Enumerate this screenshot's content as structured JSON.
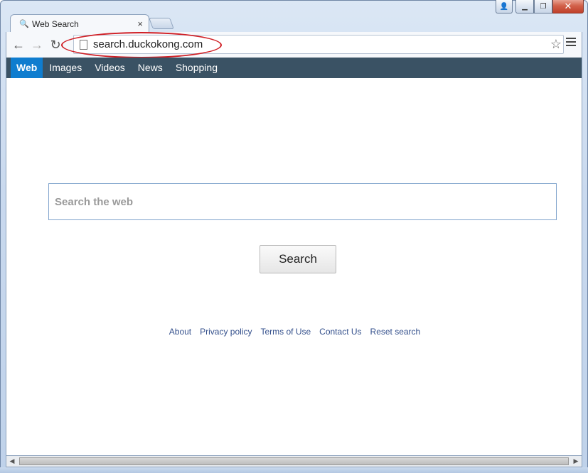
{
  "tab": {
    "title": "Web Search",
    "close_glyph": "×",
    "icon": "search-icon"
  },
  "address_bar": {
    "url": "search.duckokong.com"
  },
  "nav": {
    "back_glyph": "←",
    "forward_glyph": "→",
    "reload_glyph": "↻",
    "star_glyph": "☆"
  },
  "categories": [
    {
      "label": "Web",
      "active": true
    },
    {
      "label": "Images",
      "active": false
    },
    {
      "label": "Videos",
      "active": false
    },
    {
      "label": "News",
      "active": false
    },
    {
      "label": "Shopping",
      "active": false
    }
  ],
  "search": {
    "placeholder": "Search the web",
    "button_label": "Search"
  },
  "footer": {
    "links": [
      "About",
      "Privacy policy",
      "Terms of Use",
      "Contact Us",
      "Reset search"
    ]
  },
  "colors": {
    "navbar_bg": "#3a5264",
    "active_category": "#0f7dcf",
    "highlight": "#d01f25",
    "footer_link": "#34508c"
  }
}
